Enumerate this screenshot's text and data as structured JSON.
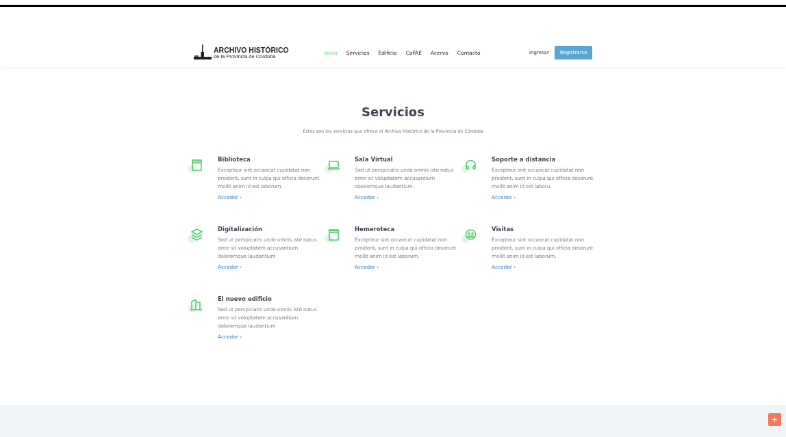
{
  "header": {
    "logo": {
      "title": "ARCHIVO HISTÓRICO",
      "subtitle": "de la Provincia de Córdoba"
    },
    "nav": [
      {
        "label": "Inicio",
        "selected": true
      },
      {
        "label": "Servicios",
        "selected": false
      },
      {
        "label": "Edificio",
        "selected": false
      },
      {
        "label": "CoFAE",
        "selected": false
      },
      {
        "label": "Acervo",
        "selected": false
      },
      {
        "label": "Contacto",
        "selected": false
      }
    ],
    "login": "Ingresar",
    "register": "Registrarse"
  },
  "section": {
    "title": "Servicios",
    "subtitle": "Estos son los servicios que ofrece el Archivo Histórico de la Provincia de Córdoba",
    "services": [
      {
        "title": "Biblioteca",
        "text": "Excepteur sint occaecat cupidatat non proident, sunt in culpa qui officia deserunt mollit anim id est laborum.",
        "link": "Acceder ›"
      },
      {
        "title": "Sala Virtual",
        "text": "Sed ut perspiciatis unde omnis iste natus error sit voluptatem accusantium doloremque laudantium.",
        "link": "Acceder ›"
      },
      {
        "title": "Soporte a distancia",
        "text": "Excepteur sint occaecat cupidatat non proident, sunt in culpa qui officia deserunt mollit anim id est laboru.",
        "link": "Acceder ›"
      },
      {
        "title": "Digitalización",
        "text": "Sed ut perspiciatis unde omnis iste natus error sit voluptatem accusantium doloremque laudantium",
        "link": "Acceder ›"
      },
      {
        "title": "Hemeroteca",
        "text": "Excepteur sint occaecat cupidatat non proident, sunt in culpa qui officia deserunt mollit anim id est laborum.",
        "link": "Acceder ›"
      },
      {
        "title": "Visitas",
        "text": "Excepteur sint occaecat cupidatat non proident, sunt in culpa qui officia deserunt mollit anim id est laborum.",
        "link": "Acceder ›"
      },
      {
        "title": "El nuevo edificio",
        "text": "Sed ut perspiciatis unde omnis iste natus error sit voluptatem accusantium doloremque laudantium",
        "link": "Acceder ›"
      }
    ]
  }
}
